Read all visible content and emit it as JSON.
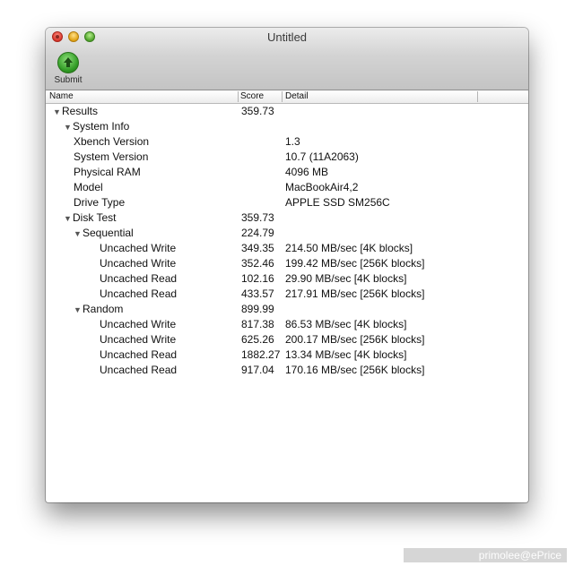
{
  "window": {
    "title": "Untitled",
    "toolbar": {
      "submit_label": "Submit"
    }
  },
  "columns": {
    "name": "Name",
    "score": "Score",
    "detail": "Detail"
  },
  "rows": [
    {
      "name": "Results",
      "score": "359.73",
      "detail": "",
      "level": 0,
      "disclosure": true
    },
    {
      "name": "System Info",
      "score": "",
      "detail": "",
      "level": 1,
      "disclosure": true
    },
    {
      "name": "Xbench Version",
      "score": "",
      "detail": "1.3",
      "level": 2,
      "disclosure": false
    },
    {
      "name": "System Version",
      "score": "",
      "detail": "10.7 (11A2063)",
      "level": 2,
      "disclosure": false
    },
    {
      "name": "Physical RAM",
      "score": "",
      "detail": "4096 MB",
      "level": 2,
      "disclosure": false
    },
    {
      "name": "Model",
      "score": "",
      "detail": "MacBookAir4,2",
      "level": 2,
      "disclosure": false
    },
    {
      "name": "Drive Type",
      "score": "",
      "detail": "APPLE SSD SM256C",
      "level": 2,
      "disclosure": false
    },
    {
      "name": "Disk Test",
      "score": "359.73",
      "detail": "",
      "level": 1,
      "disclosure": true
    },
    {
      "name": "Sequential",
      "score": "224.79",
      "detail": "",
      "level": 2,
      "disclosure": true
    },
    {
      "name": "Uncached Write",
      "score": "349.35",
      "detail": "214.50 MB/sec [4K blocks]",
      "level": 3,
      "disclosure": false
    },
    {
      "name": "Uncached Write",
      "score": "352.46",
      "detail": "199.42 MB/sec [256K blocks]",
      "level": 3,
      "disclosure": false
    },
    {
      "name": "Uncached Read",
      "score": "102.16",
      "detail": "29.90 MB/sec [4K blocks]",
      "level": 3,
      "disclosure": false
    },
    {
      "name": "Uncached Read",
      "score": "433.57",
      "detail": "217.91 MB/sec [256K blocks]",
      "level": 3,
      "disclosure": false
    },
    {
      "name": "Random",
      "score": "899.99",
      "detail": "",
      "level": 2,
      "disclosure": true
    },
    {
      "name": "Uncached Write",
      "score": "817.38",
      "detail": "86.53 MB/sec [4K blocks]",
      "level": 3,
      "disclosure": false
    },
    {
      "name": "Uncached Write",
      "score": "625.26",
      "detail": "200.17 MB/sec [256K blocks]",
      "level": 3,
      "disclosure": false
    },
    {
      "name": "Uncached Read",
      "score": "1882.27",
      "detail": "13.34 MB/sec [4K blocks]",
      "level": 3,
      "disclosure": false
    },
    {
      "name": "Uncached Read",
      "score": "917.04",
      "detail": "170.16 MB/sec [256K blocks]",
      "level": 3,
      "disclosure": false
    }
  ],
  "watermark": "primolee@ePrice",
  "colors": {
    "submit_icon": "#3aa82c",
    "close": "#e0443a",
    "minimize": "#e8a820",
    "zoom": "#5ab536"
  }
}
